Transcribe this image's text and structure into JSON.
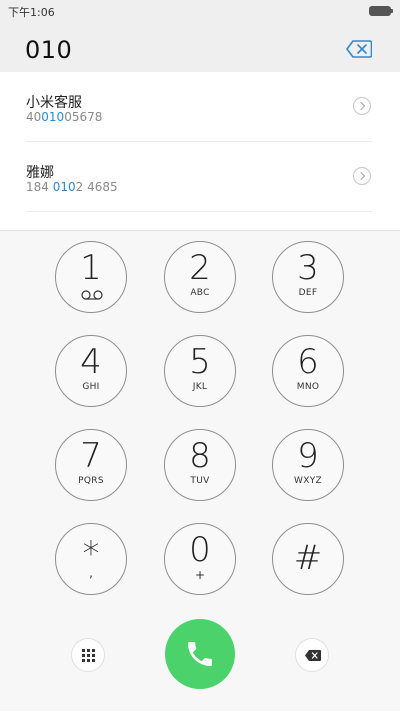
{
  "status_bar": {
    "time": "下午1:06"
  },
  "dialer": {
    "number": "010"
  },
  "contacts": [
    {
      "name": "小米客服",
      "number_pre": "40",
      "number_match": "010",
      "number_post": "05678"
    },
    {
      "name": "雅娜",
      "number_pre": "184 ",
      "number_match": "010",
      "number_post": "2 4685"
    }
  ],
  "keypad": {
    "keys": [
      {
        "digit": "1",
        "letters": ""
      },
      {
        "digit": "2",
        "letters": "ABC"
      },
      {
        "digit": "3",
        "letters": "DEF"
      },
      {
        "digit": "4",
        "letters": "GHI"
      },
      {
        "digit": "5",
        "letters": "JKL"
      },
      {
        "digit": "6",
        "letters": "MNO"
      },
      {
        "digit": "7",
        "letters": "PQRS"
      },
      {
        "digit": "8",
        "letters": "TUV"
      },
      {
        "digit": "9",
        "letters": "WXYZ"
      },
      {
        "digit": "*",
        "letters": ","
      },
      {
        "digit": "0",
        "letters": "+"
      },
      {
        "digit": "#",
        "letters": ""
      }
    ]
  },
  "colors": {
    "accent": "#2a8ad4",
    "call": "#4cd26a"
  },
  "icons": {
    "clear": "backspace-icon",
    "voicemail": "voicemail-icon",
    "keypad": "keypad-grid-icon",
    "call": "phone-icon",
    "delete": "backspace-icon"
  }
}
